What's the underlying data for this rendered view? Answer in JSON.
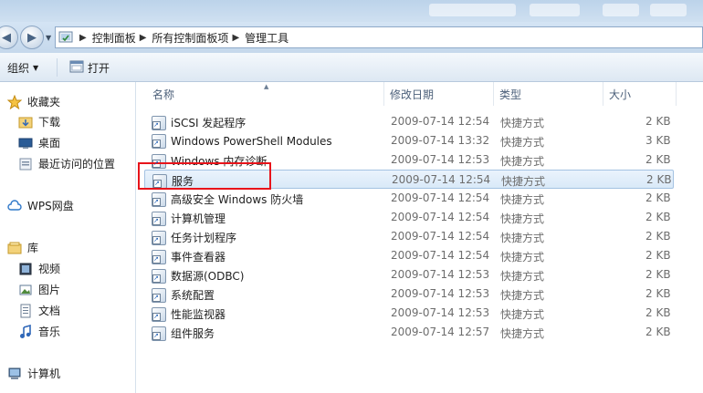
{
  "address": {
    "crumbs": [
      "控制面板",
      "所有控制面板项",
      "管理工具"
    ]
  },
  "toolbar": {
    "organize_label": "组织",
    "open_label": "打开"
  },
  "nav": {
    "favorites": "收藏夹",
    "downloads": "下载",
    "desktop": "桌面",
    "recent": "最近访问的位置",
    "wps": "WPS网盘",
    "library": "库",
    "videos": "视频",
    "pictures": "图片",
    "documents": "文档",
    "music": "音乐",
    "computer": "计算机"
  },
  "columns": {
    "name": "名称",
    "date": "修改日期",
    "type": "类型",
    "size": "大小"
  },
  "files": [
    {
      "name": "iSCSI 发起程序",
      "date": "2009-07-14 12:54",
      "type": "快捷方式",
      "size": "2 KB"
    },
    {
      "name": "Windows PowerShell Modules",
      "date": "2009-07-14 13:32",
      "type": "快捷方式",
      "size": "3 KB"
    },
    {
      "name": "Windows 内存诊断",
      "date": "2009-07-14 12:53",
      "type": "快捷方式",
      "size": "2 KB"
    },
    {
      "name": "服务",
      "date": "2009-07-14 12:54",
      "type": "快捷方式",
      "size": "2 KB"
    },
    {
      "name": "高级安全 Windows 防火墙",
      "date": "2009-07-14 12:54",
      "type": "快捷方式",
      "size": "2 KB"
    },
    {
      "name": "计算机管理",
      "date": "2009-07-14 12:54",
      "type": "快捷方式",
      "size": "2 KB"
    },
    {
      "name": "任务计划程序",
      "date": "2009-07-14 12:54",
      "type": "快捷方式",
      "size": "2 KB"
    },
    {
      "name": "事件查看器",
      "date": "2009-07-14 12:54",
      "type": "快捷方式",
      "size": "2 KB"
    },
    {
      "name": "数据源(ODBC)",
      "date": "2009-07-14 12:53",
      "type": "快捷方式",
      "size": "2 KB"
    },
    {
      "name": "系统配置",
      "date": "2009-07-14 12:53",
      "type": "快捷方式",
      "size": "2 KB"
    },
    {
      "name": "性能监视器",
      "date": "2009-07-14 12:53",
      "type": "快捷方式",
      "size": "2 KB"
    },
    {
      "name": "组件服务",
      "date": "2009-07-14 12:57",
      "type": "快捷方式",
      "size": "2 KB"
    }
  ],
  "selected_row": 3,
  "colors": {
    "highlight_box": "#e8141b",
    "selection": "#d9e9f8"
  }
}
